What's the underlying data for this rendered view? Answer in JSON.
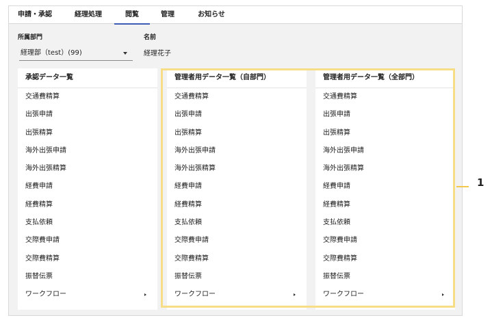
{
  "tabs": [
    {
      "label": "申請・承認"
    },
    {
      "label": "経理処理"
    },
    {
      "label": "閲覧"
    },
    {
      "label": "管理"
    },
    {
      "label": "お知らせ"
    }
  ],
  "filters": {
    "department_label": "所属部門",
    "department_value": "経理部（test）(99)",
    "name_label": "名前",
    "name_value": "経理花子"
  },
  "panels": [
    {
      "title": "承認データ一覧",
      "items": [
        "交通費精算",
        "出張申請",
        "出張精算",
        "海外出張申請",
        "海外出張精算",
        "経費申請",
        "経費精算",
        "支払依頼",
        "交際費申請",
        "交際費精算",
        "振替伝票",
        "ワークフロー"
      ]
    },
    {
      "title": "管理者用データ一覧（自部門）",
      "items": [
        "交通費精算",
        "出張申請",
        "出張精算",
        "海外出張申請",
        "海外出張精算",
        "経費申請",
        "経費精算",
        "支払依頼",
        "交際費申請",
        "交際費精算",
        "振替伝票",
        "ワークフロー"
      ]
    },
    {
      "title": "管理者用データ一覧（全部門）",
      "items": [
        "交通費精算",
        "出張申請",
        "出張精算",
        "海外出張申請",
        "海外出張精算",
        "経費申請",
        "経費精算",
        "支払依頼",
        "交際費申請",
        "交際費精算",
        "振替伝票",
        "ワークフロー"
      ]
    }
  ],
  "callout": {
    "number": "1",
    "color": "#f7dd85"
  },
  "colors": {
    "active_tab_underline": "#3b5bb5",
    "background": "#f2f2f2"
  }
}
